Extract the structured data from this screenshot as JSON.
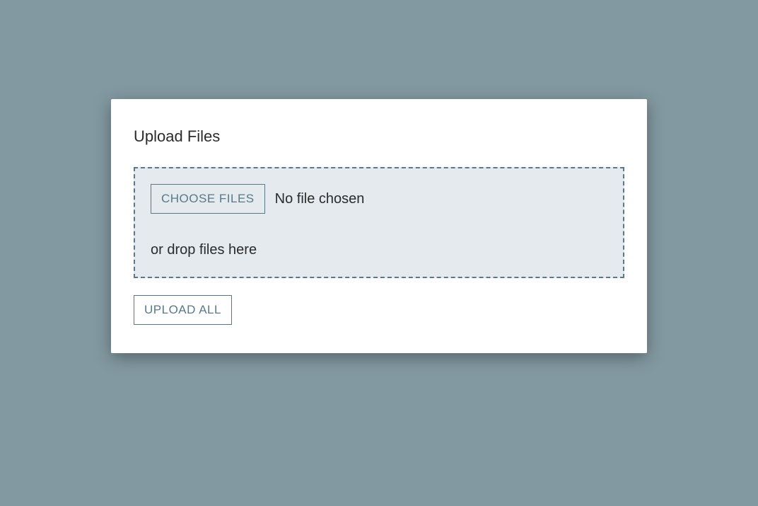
{
  "card": {
    "title": "Upload Files",
    "chooseLabel": "CHOOSE FILES",
    "fileStatus": "No file chosen",
    "dropHint": "or drop files here",
    "uploadAllLabel": "UPLOAD ALL"
  }
}
